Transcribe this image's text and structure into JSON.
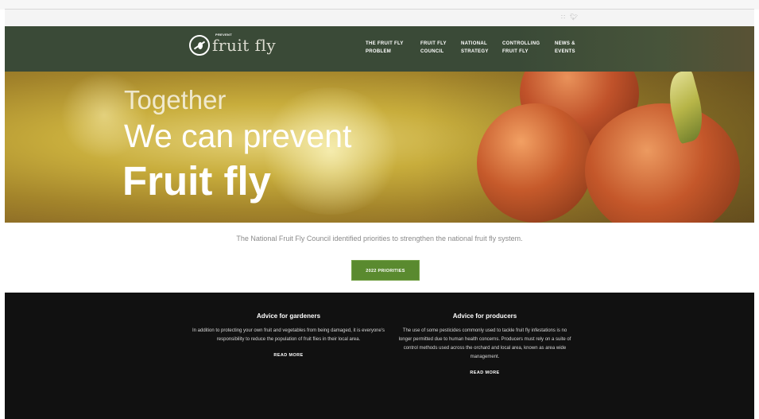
{
  "social": {
    "rss_icon": "Ճ",
    "twitter_icon": "ᵧ"
  },
  "brand": {
    "small": "PREVENT",
    "name": "fruit fly"
  },
  "nav": {
    "items": [
      {
        "line1": "THE FRUIT FLY",
        "line2": "PROBLEM"
      },
      {
        "line1": "FRUIT FLY",
        "line2": "COUNCIL"
      },
      {
        "line1": "NATIONAL",
        "line2": "STRATEGY"
      },
      {
        "line1": "CONTROLLING",
        "line2": "FRUIT FLY"
      },
      {
        "line1": "NEWS &",
        "line2": "EVENTS"
      }
    ]
  },
  "hero": {
    "line1": "Together",
    "line2": "We can prevent",
    "line3": "Fruit fly"
  },
  "intro": {
    "text": "The National Fruit Fly Council identified priorities to strengthen the national fruit fly system.",
    "button": "2022 PRIORITIES"
  },
  "advice": {
    "gardeners": {
      "title": "Advice for gardeners",
      "body": "In addition to protecting your own fruit and vegetables from being damaged, it is everyone's responsibility to reduce the population of fruit flies in their local area.",
      "more": "READ MORE"
    },
    "producers": {
      "title": "Advice for producers",
      "body": "The use of some pesticides commonly used to tackle fruit fly infestations is no longer permitted due to human health concerns. Producers must rely on a suite of control methods used across the orchard and local area, known as area wide management.",
      "more": "READ MORE"
    }
  },
  "colors": {
    "nav_bg": "#3a4a37",
    "accent": "#5a8a2f",
    "footer_bg": "#111111"
  }
}
